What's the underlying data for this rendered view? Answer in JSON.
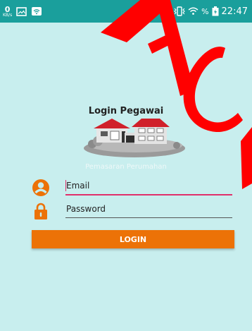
{
  "status_bar": {
    "net_speed_value": "0",
    "net_speed_unit": "KB/s",
    "battery_percent": "%",
    "time": "22:47",
    "icons": [
      "net-speed-icon",
      "image-notification-icon",
      "wifi-notification-icon",
      "vibrate-icon",
      "wifi-signal-icon",
      "battery-icon"
    ]
  },
  "login": {
    "title": "Login Pegawai",
    "subtitle": "Pemasaran Perumahan",
    "email_placeholder": "Email",
    "password_placeholder": "Password",
    "button_label": "LOGIN"
  },
  "colors": {
    "status_bar": "#1a9f9c",
    "background": "#c8eeee",
    "accent": "#ec7207",
    "focus_underline": "#e0306a",
    "watermark": "#ff0000"
  }
}
